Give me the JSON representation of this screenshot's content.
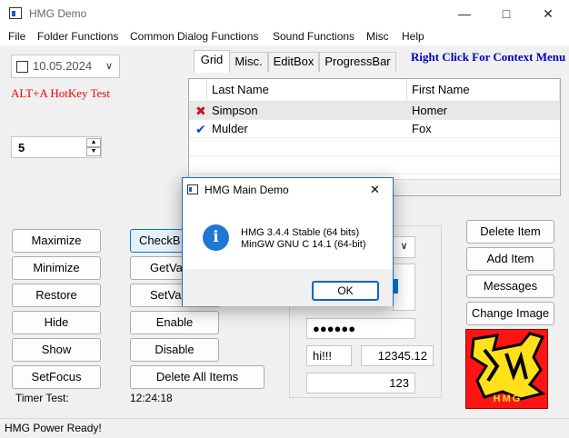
{
  "window": {
    "title": "HMG Demo"
  },
  "menu": [
    "File",
    "Folder Functions",
    "Common Dialog Functions",
    "Sound Functions",
    "Misc",
    "Help"
  ],
  "date_picker": {
    "value": "10.05.2024"
  },
  "hotkey_label": "ALT+A HotKey Test",
  "spinner": {
    "value": "5"
  },
  "context_menu_hint": "Right Click For Context Menu",
  "tabs": [
    "Grid",
    "Misc.",
    "EditBox",
    "ProgressBar"
  ],
  "grid": {
    "headers": [
      "Last Name",
      "First Name"
    ],
    "rows": [
      {
        "last": "Simpson",
        "first": "Homer",
        "icon": "x-mark-icon"
      },
      {
        "last": "Mulder",
        "first": "Fox",
        "icon": "check-mark-icon"
      }
    ]
  },
  "left_buttons": [
    "Maximize",
    "Minimize",
    "Restore",
    "Hide",
    "Show",
    "SetFocus"
  ],
  "mid_buttons": [
    "CheckB",
    "GetVa",
    "SetVa",
    "Enable",
    "Disable",
    "Delete All Items"
  ],
  "right_buttons": [
    "Delete Item",
    "Add Item",
    "Messages",
    "Change Image"
  ],
  "timer": {
    "label": "Timer Test:",
    "value": "12:24:18"
  },
  "fields": {
    "password": "●●●●●●",
    "text": "hi!!!",
    "number": "12345.12",
    "integer": "123"
  },
  "status": "HMG Power Ready!",
  "logo_text": "HMG",
  "dialog": {
    "title": "HMG Main Demo",
    "lines": [
      "HMG 3.4.4 Stable (64 bits)",
      "MinGW GNU C 14.1 (64-bit)"
    ],
    "ok": "OK"
  },
  "colors": {
    "accent": "#0078d7",
    "hotkey": "#e00000",
    "hint": "#0000c0",
    "logo": "#ff1414"
  }
}
